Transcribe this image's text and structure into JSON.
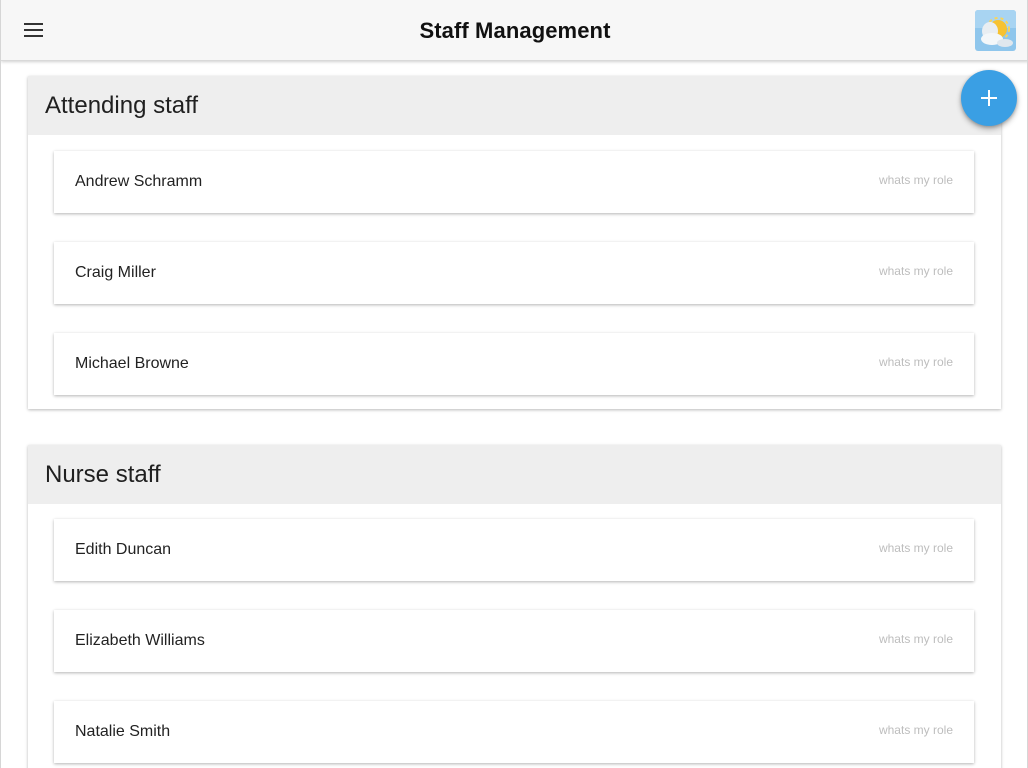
{
  "app": {
    "title": "Staff Management",
    "menu_icon": "hamburger-menu-icon",
    "avatar_icon": "weather-avatar-icon",
    "add_icon": "plus-icon",
    "accent_color": "#3a9fe4"
  },
  "sections": [
    {
      "title": "Attending staff",
      "staff": [
        {
          "name": "Andrew Schramm",
          "role": "whats my role"
        },
        {
          "name": "Craig Miller",
          "role": "whats my role"
        },
        {
          "name": "Michael Browne",
          "role": "whats my role"
        }
      ]
    },
    {
      "title": "Nurse staff",
      "staff": [
        {
          "name": "Edith Duncan",
          "role": "whats my role"
        },
        {
          "name": "Elizabeth Williams",
          "role": "whats my role"
        },
        {
          "name": "Natalie Smith",
          "role": "whats my role"
        }
      ]
    }
  ]
}
